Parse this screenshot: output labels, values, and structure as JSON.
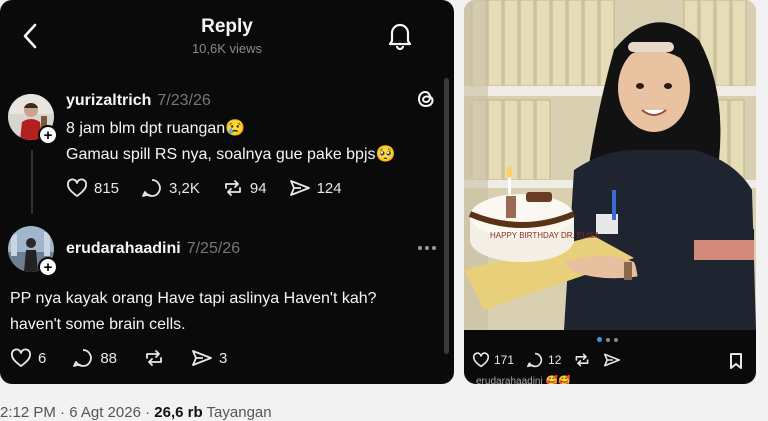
{
  "header": {
    "title": "Reply",
    "views": "10,6K views"
  },
  "posts": [
    {
      "username": "yurizaltrich",
      "date": "7/23/26",
      "lines": [
        "8 jam blm dpt ruangan😢",
        "Gamau spill RS nya, soalnya gue pake bpjs🥺"
      ],
      "likes": "815",
      "comments": "3,2K",
      "reposts": "94",
      "shares": "124"
    },
    {
      "username": "erudarahaadini",
      "date": "7/25/26",
      "lines": [
        "PP nya kayak orang Have tapi aslinya Haven't kah?",
        "haven't some brain cells."
      ],
      "likes": "6",
      "comments": "88",
      "shares": "3"
    }
  ],
  "image_card": {
    "cake_text": "HAPPY BIRTHDAY DR. ELISA",
    "likes": "171",
    "comments": "12",
    "caption_partial": "erudarahaadini 🥰🥰"
  },
  "footer": {
    "time": "2:12 PM · 6 Agt 2026 ·",
    "views_bold": "26,6 rb",
    "views_label": "Tayangan"
  }
}
